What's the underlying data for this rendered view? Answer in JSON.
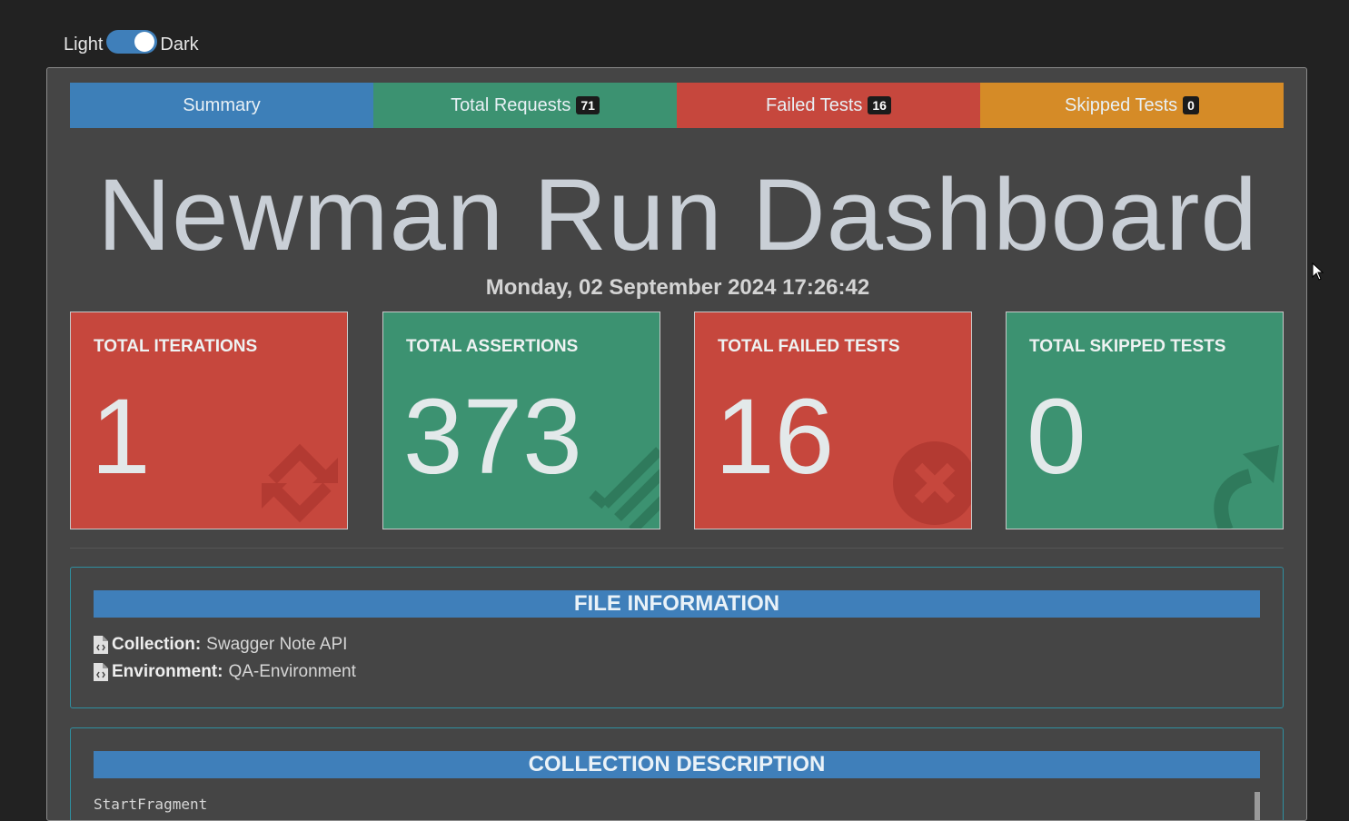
{
  "theme_toggle": {
    "light_label": "Light",
    "dark_label": "Dark",
    "state": "dark"
  },
  "tabs": [
    {
      "label": "Summary",
      "badge": null,
      "color": "#3d7fb8",
      "active": true
    },
    {
      "label": "Total Requests",
      "badge": "71",
      "color": "#3c9271"
    },
    {
      "label": "Failed Tests",
      "badge": "16",
      "color": "#c6473d"
    },
    {
      "label": "Skipped Tests",
      "badge": "0",
      "color": "#d58b27"
    }
  ],
  "header": {
    "title": "Newman Run Dashboard",
    "run_date": "Monday, 02 September 2024 17:26:42"
  },
  "cards": [
    {
      "title": "TOTAL ITERATIONS",
      "value": "1",
      "icon": "sync-icon",
      "color": "#c6473d"
    },
    {
      "title": "TOTAL ASSERTIONS",
      "value": "373",
      "icon": "tasks-icon",
      "color": "#3c9271"
    },
    {
      "title": "TOTAL FAILED TESTS",
      "value": "16",
      "icon": "times-circle-icon",
      "color": "#c6473d"
    },
    {
      "title": "TOTAL SKIPPED TESTS",
      "value": "0",
      "icon": "share-arrow-icon",
      "color": "#3c9271"
    }
  ],
  "file_information": {
    "heading": "FILE INFORMATION",
    "collection_label": "Collection:",
    "collection_value": "Swagger Note API",
    "environment_label": "Environment:",
    "environment_value": "QA-Environment"
  },
  "collection_description": {
    "heading": "COLLECTION DESCRIPTION",
    "text": "StartFragment"
  }
}
